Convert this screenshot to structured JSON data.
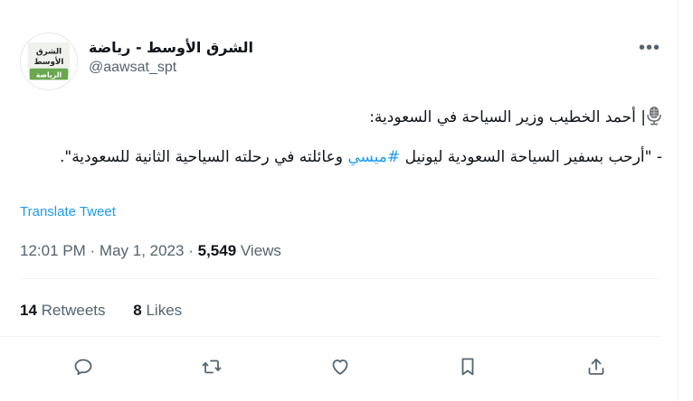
{
  "tweet": {
    "author": {
      "display_name": "الشرق الأوسط - رياضة",
      "handle": "@aawsat_spt",
      "avatar_text_line1": "الشرق",
      "avatar_text_line2": "الأوسط",
      "avatar_text_line3": "الرياضة"
    },
    "more_label": "•••",
    "body": {
      "line1_icon": "microphone-icon",
      "line1_text": "| أحمد الخطيب وزير السياحة في السعودية:",
      "line2_before": "- \"أرحب بسفير السياحة السعودية ليونيل ",
      "line2_hashtag": "#ميسي",
      "line2_after": " وعائلته في رحلته السياحية الثانية للسعودية\"."
    },
    "translate_label": "Translate Tweet",
    "time": "12:01 PM",
    "separator": "·",
    "date": "May 1, 2023",
    "views_count": "5,549",
    "views_label": "Views",
    "retweets_count": "14",
    "retweets_label": "Retweets",
    "likes_count": "8",
    "likes_label": "Likes",
    "actions": [
      "reply-icon",
      "retweet-icon",
      "like-icon",
      "bookmark-icon",
      "share-icon"
    ],
    "colors": {
      "accent": "#1d9bf0",
      "text": "#0f1419",
      "muted": "#536471",
      "divider": "#eff3f4"
    }
  }
}
